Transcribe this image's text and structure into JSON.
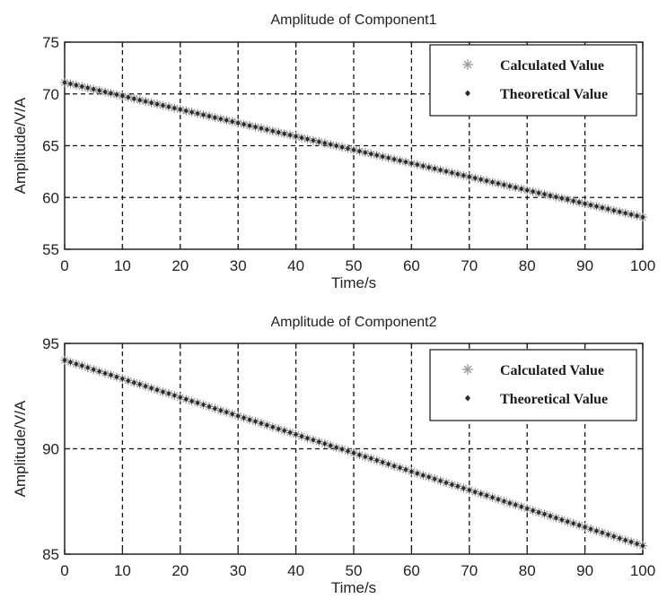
{
  "chart_data": [
    {
      "type": "line",
      "title": "Amplitude of Component1",
      "xlabel": "Time/s",
      "ylabel": "Amplitude/V/A",
      "xlim": [
        0,
        100
      ],
      "ylim": [
        55,
        75
      ],
      "xticks": [
        "0",
        "10",
        "20",
        "30",
        "40",
        "50",
        "60",
        "70",
        "80",
        "90",
        "100"
      ],
      "yticks": [
        "55",
        "60",
        "65",
        "70",
        "75"
      ],
      "grid": true,
      "legend_position": "top-right",
      "x": [
        0,
        1,
        2,
        3,
        4,
        5,
        6,
        7,
        8,
        9,
        10,
        11,
        12,
        13,
        14,
        15,
        16,
        17,
        18,
        19,
        20,
        21,
        22,
        23,
        24,
        25,
        26,
        27,
        28,
        29,
        30,
        31,
        32,
        33,
        34,
        35,
        36,
        37,
        38,
        39,
        40,
        41,
        42,
        43,
        44,
        45,
        46,
        47,
        48,
        49,
        50,
        51,
        52,
        53,
        54,
        55,
        56,
        57,
        58,
        59,
        60,
        61,
        62,
        63,
        64,
        65,
        66,
        67,
        68,
        69,
        70,
        71,
        72,
        73,
        74,
        75,
        76,
        77,
        78,
        79,
        80,
        81,
        82,
        83,
        84,
        85,
        86,
        87,
        88,
        89,
        90,
        91,
        92,
        93,
        94,
        95,
        96,
        97,
        98,
        99,
        100
      ],
      "series": [
        {
          "name": "Calculated Value",
          "marker": "asterisk",
          "color": "#9a9a9a",
          "values": [
            71.1,
            70.97,
            70.84,
            70.71,
            70.58,
            70.45,
            70.32,
            70.19,
            70.06,
            69.93,
            69.8,
            69.67,
            69.54,
            69.41,
            69.28,
            69.15,
            69.02,
            68.89,
            68.76,
            68.63,
            68.5,
            68.37,
            68.24,
            68.11,
            67.98,
            67.85,
            67.72,
            67.59,
            67.46,
            67.33,
            67.2,
            67.07,
            66.94,
            66.81,
            66.68,
            66.55,
            66.42,
            66.29,
            66.16,
            66.03,
            65.9,
            65.77,
            65.64,
            65.51,
            65.38,
            65.25,
            65.12,
            64.99,
            64.86,
            64.73,
            64.6,
            64.47,
            64.34,
            64.21,
            64.08,
            63.95,
            63.82,
            63.69,
            63.56,
            63.43,
            63.3,
            63.17,
            63.04,
            62.91,
            62.78,
            62.65,
            62.52,
            62.39,
            62.26,
            62.13,
            62.0,
            61.87,
            61.74,
            61.61,
            61.48,
            61.35,
            61.22,
            61.09,
            60.96,
            60.83,
            60.7,
            60.57,
            60.44,
            60.31,
            60.18,
            60.05,
            59.92,
            59.79,
            59.66,
            59.53,
            59.4,
            59.27,
            59.14,
            59.01,
            58.88,
            58.75,
            58.62,
            58.49,
            58.36,
            58.23,
            58.1
          ]
        },
        {
          "name": "Theoretical Value",
          "marker": "diamond",
          "color": "#2a2a2a",
          "values": [
            71.1,
            70.97,
            70.84,
            70.71,
            70.58,
            70.45,
            70.32,
            70.19,
            70.06,
            69.93,
            69.8,
            69.67,
            69.54,
            69.41,
            69.28,
            69.15,
            69.02,
            68.89,
            68.76,
            68.63,
            68.5,
            68.37,
            68.24,
            68.11,
            67.98,
            67.85,
            67.72,
            67.59,
            67.46,
            67.33,
            67.2,
            67.07,
            66.94,
            66.81,
            66.68,
            66.55,
            66.42,
            66.29,
            66.16,
            66.03,
            65.9,
            65.77,
            65.64,
            65.51,
            65.38,
            65.25,
            65.12,
            64.99,
            64.86,
            64.73,
            64.6,
            64.47,
            64.34,
            64.21,
            64.08,
            63.95,
            63.82,
            63.69,
            63.56,
            63.43,
            63.3,
            63.17,
            63.04,
            62.91,
            62.78,
            62.65,
            62.52,
            62.39,
            62.26,
            62.13,
            62.0,
            61.87,
            61.74,
            61.61,
            61.48,
            61.35,
            61.22,
            61.09,
            60.96,
            60.83,
            60.7,
            60.57,
            60.44,
            60.31,
            60.18,
            60.05,
            59.92,
            59.79,
            59.66,
            59.53,
            59.4,
            59.27,
            59.14,
            59.01,
            58.88,
            58.75,
            58.62,
            58.49,
            58.36,
            58.23,
            58.1
          ]
        }
      ]
    },
    {
      "type": "line",
      "title": "Amplitude of Component2",
      "xlabel": "Time/s",
      "ylabel": "Amplitude/V/A",
      "xlim": [
        0,
        100
      ],
      "ylim": [
        85,
        95
      ],
      "xticks": [
        "0",
        "10",
        "20",
        "30",
        "40",
        "50",
        "60",
        "70",
        "80",
        "90",
        "100"
      ],
      "yticks": [
        "85",
        "90",
        "95"
      ],
      "grid": true,
      "legend_position": "top-right",
      "x": [
        0,
        1,
        2,
        3,
        4,
        5,
        6,
        7,
        8,
        9,
        10,
        11,
        12,
        13,
        14,
        15,
        16,
        17,
        18,
        19,
        20,
        21,
        22,
        23,
        24,
        25,
        26,
        27,
        28,
        29,
        30,
        31,
        32,
        33,
        34,
        35,
        36,
        37,
        38,
        39,
        40,
        41,
        42,
        43,
        44,
        45,
        46,
        47,
        48,
        49,
        50,
        51,
        52,
        53,
        54,
        55,
        56,
        57,
        58,
        59,
        60,
        61,
        62,
        63,
        64,
        65,
        66,
        67,
        68,
        69,
        70,
        71,
        72,
        73,
        74,
        75,
        76,
        77,
        78,
        79,
        80,
        81,
        82,
        83,
        84,
        85,
        86,
        87,
        88,
        89,
        90,
        91,
        92,
        93,
        94,
        95,
        96,
        97,
        98,
        99,
        100
      ],
      "series": [
        {
          "name": "Calculated Value",
          "marker": "asterisk",
          "color": "#9a9a9a",
          "values": [
            94.2,
            94.11,
            94.02,
            93.94,
            93.85,
            93.76,
            93.67,
            93.58,
            93.5,
            93.41,
            93.32,
            93.23,
            93.14,
            93.06,
            92.97,
            92.88,
            92.79,
            92.7,
            92.62,
            92.53,
            92.44,
            92.35,
            92.26,
            92.18,
            92.09,
            92.0,
            91.91,
            91.82,
            91.74,
            91.65,
            91.56,
            91.47,
            91.38,
            91.3,
            91.21,
            91.12,
            91.03,
            90.94,
            90.86,
            90.77,
            90.68,
            90.59,
            90.5,
            90.42,
            90.33,
            90.24,
            90.15,
            90.06,
            89.98,
            89.89,
            89.8,
            89.71,
            89.62,
            89.54,
            89.45,
            89.36,
            89.27,
            89.18,
            89.1,
            89.01,
            88.92,
            88.83,
            88.74,
            88.66,
            88.57,
            88.48,
            88.39,
            88.3,
            88.22,
            88.13,
            88.04,
            87.95,
            87.86,
            87.78,
            87.69,
            87.6,
            87.51,
            87.42,
            87.34,
            87.25,
            87.16,
            87.07,
            86.98,
            86.9,
            86.81,
            86.72,
            86.63,
            86.54,
            86.46,
            86.37,
            86.28,
            86.19,
            86.1,
            86.02,
            85.93,
            85.84,
            85.75,
            85.66,
            85.58,
            85.49,
            85.4
          ]
        },
        {
          "name": "Theoretical Value",
          "marker": "diamond",
          "color": "#2a2a2a",
          "values": [
            94.2,
            94.11,
            94.02,
            93.94,
            93.85,
            93.76,
            93.67,
            93.58,
            93.5,
            93.41,
            93.32,
            93.23,
            93.14,
            93.06,
            92.97,
            92.88,
            92.79,
            92.7,
            92.62,
            92.53,
            92.44,
            92.35,
            92.26,
            92.18,
            92.09,
            92.0,
            91.91,
            91.82,
            91.74,
            91.65,
            91.56,
            91.47,
            91.38,
            91.3,
            91.21,
            91.12,
            91.03,
            90.94,
            90.86,
            90.77,
            90.68,
            90.59,
            90.5,
            90.42,
            90.33,
            90.24,
            90.15,
            90.06,
            89.98,
            89.89,
            89.8,
            89.71,
            89.62,
            89.54,
            89.45,
            89.36,
            89.27,
            89.18,
            89.1,
            89.01,
            88.92,
            88.83,
            88.74,
            88.66,
            88.57,
            88.48,
            88.39,
            88.3,
            88.22,
            88.13,
            88.04,
            87.95,
            87.86,
            87.78,
            87.69,
            87.6,
            87.51,
            87.42,
            87.34,
            87.25,
            87.16,
            87.07,
            86.98,
            86.9,
            86.81,
            86.72,
            86.63,
            86.54,
            86.46,
            86.37,
            86.28,
            86.19,
            86.1,
            86.02,
            85.93,
            85.84,
            85.75,
            85.66,
            85.58,
            85.49,
            85.4
          ]
        }
      ]
    }
  ]
}
